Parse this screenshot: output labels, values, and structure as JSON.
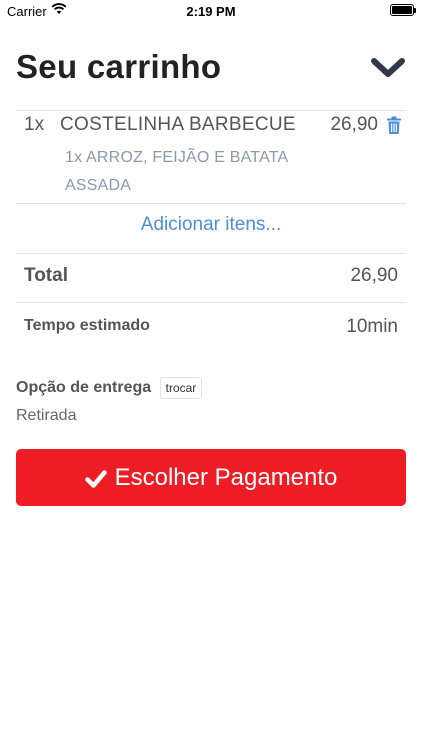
{
  "status_bar": {
    "carrier": "Carrier",
    "time": "2:19 PM"
  },
  "header": {
    "title": "Seu carrinho"
  },
  "cart": {
    "items": [
      {
        "qty": "1x",
        "name": "COSTELINHA BARBECUE",
        "price": "26,90",
        "addon": "1x ARROZ, FEIJÃO E BATATA ASSADA"
      }
    ],
    "add_items_label": "Adicionar itens..."
  },
  "summary": {
    "total_label": "Total",
    "total_value": "26,90",
    "time_label": "Tempo estimado",
    "time_value": "10min"
  },
  "delivery": {
    "label": "Opção de entrega",
    "change_label": "trocar",
    "mode": "Retirada"
  },
  "actions": {
    "pay_label": "Escolher Pagamento"
  },
  "colors": {
    "accent": "#ee1c25",
    "link": "#4a90d9",
    "addon": "#8a99a8"
  }
}
